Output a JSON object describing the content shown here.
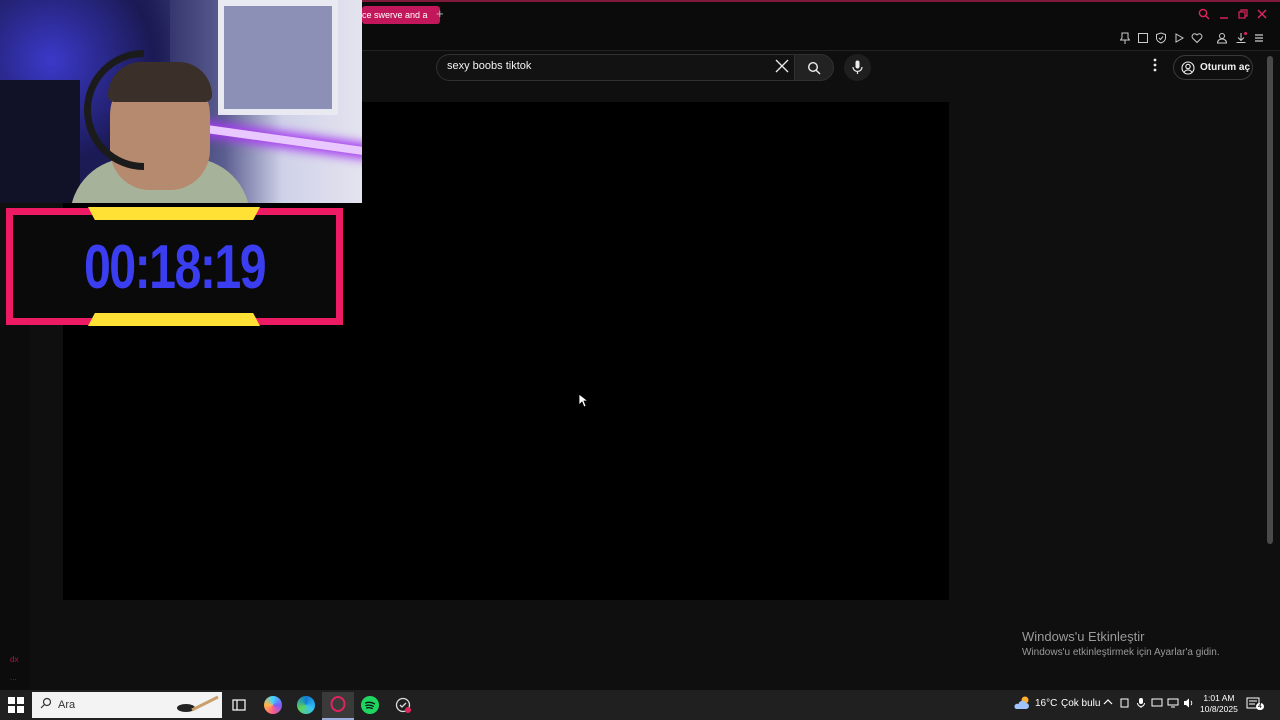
{
  "browser": {
    "tab_title": "ce swerve and a",
    "new_tab": "+",
    "window_controls": [
      "search-icon",
      "minimize-icon",
      "restore-icon",
      "close-icon"
    ]
  },
  "youtube": {
    "search_query": "sexy boobs tiktok",
    "sign_in_label": "Oturum aç"
  },
  "overlay": {
    "timer": "00:18:19",
    "sidebar_marks": [
      "dx",
      "..."
    ]
  },
  "watermark": {
    "title": "Windows'u Etkinleştir",
    "subtitle": "Windows'u etkinleştirmek için Ayarlar'a gidin."
  },
  "taskbar": {
    "search_placeholder": "Ara",
    "weather_temp": "16°C",
    "weather_text": "Çok bulu",
    "time": "1:01 AM",
    "date": "10/8/2025",
    "notification_count": "4"
  },
  "colors": {
    "accent": "#e0245e",
    "timer_border": "#ec1b63",
    "timer_text": "#3b3ef0",
    "timer_tab": "#ffe135"
  }
}
